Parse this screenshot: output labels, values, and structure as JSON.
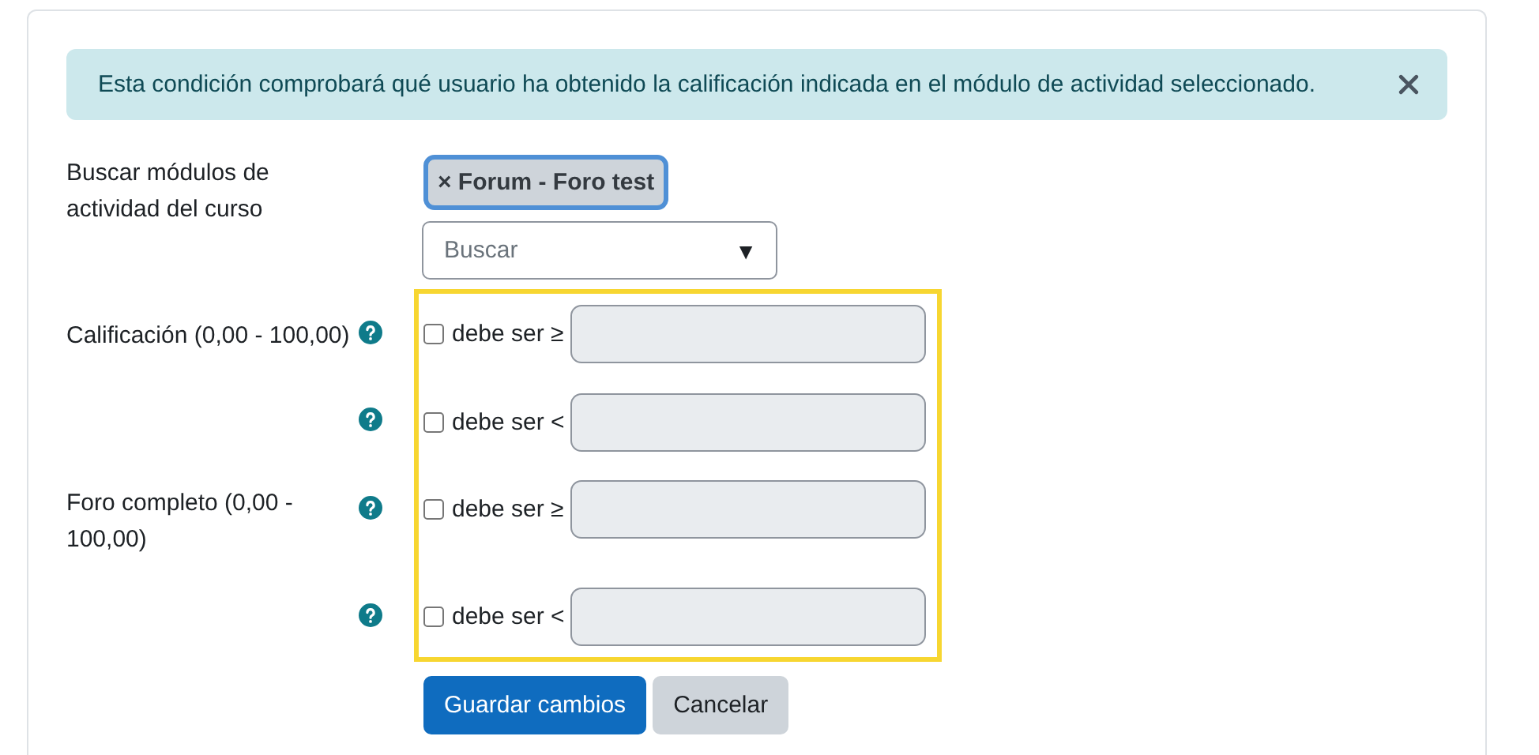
{
  "alert": {
    "text": "Esta condición comprobará qué usuario ha obtenido la calificación indicada en el módulo de actividad seleccionado."
  },
  "search": {
    "label": "Buscar módulos de actividad del curso",
    "selected_item": "× Forum - Foro test",
    "placeholder": "Buscar",
    "caret": "▼"
  },
  "conditions": [
    {
      "label": "Calificación (0,00 - 100,00)",
      "operator": "debe ser ≥",
      "checked": false
    },
    {
      "operator": "debe ser <",
      "checked": false
    },
    {
      "label": "Foro completo (0,00 - 100,00)",
      "operator": "debe ser ≥",
      "checked": false
    },
    {
      "operator": "debe ser <",
      "checked": false
    }
  ],
  "buttons": [
    {
      "label": "Guardar cambios",
      "kind": "primary"
    },
    {
      "label": "Cancelar",
      "kind": "secondary"
    }
  ]
}
